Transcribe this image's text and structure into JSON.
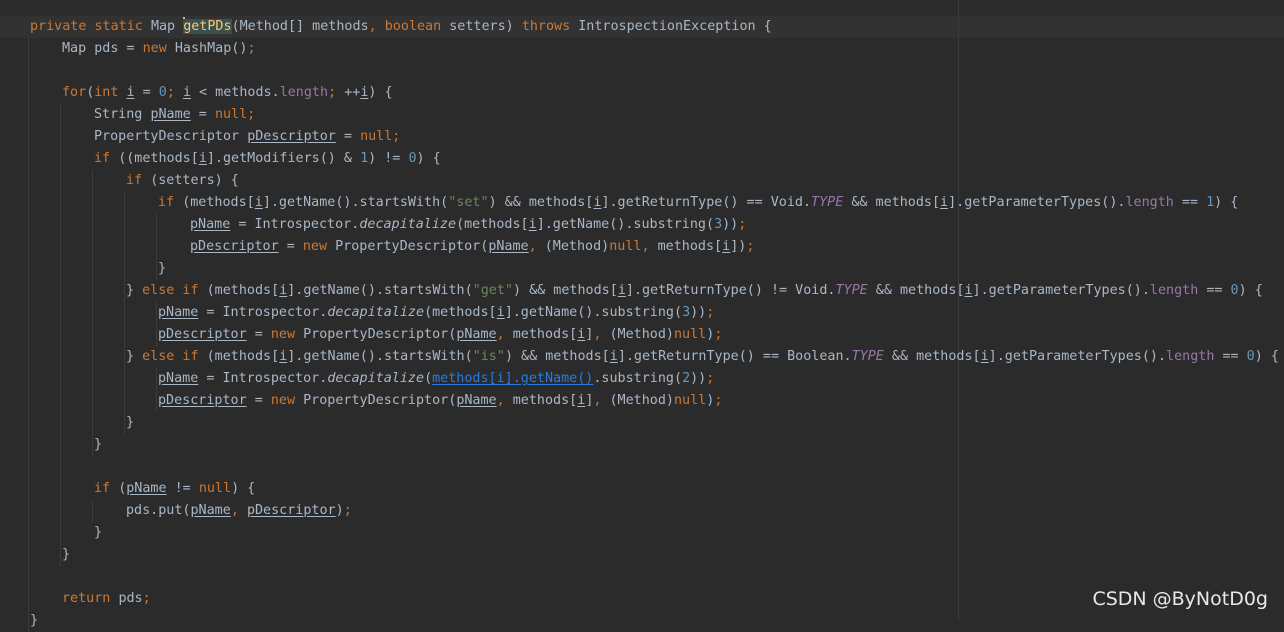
{
  "editor": {
    "lines": [
      {
        "indent": 0,
        "segs": [
          [
            "kw",
            "private static "
          ],
          [
            "",
            "Map "
          ],
          [
            "fn",
            "getPDs"
          ],
          [
            "",
            "(Method[] methods"
          ],
          [
            "kw",
            ", boolean "
          ],
          [
            "",
            "setters) "
          ],
          [
            "kw",
            "throws "
          ],
          [
            "",
            "IntrospectionException {"
          ]
        ]
      },
      {
        "indent": 1,
        "segs": [
          [
            "",
            "Map pds = "
          ],
          [
            "kw",
            "new "
          ],
          [
            "",
            "HashMap()"
          ],
          [
            "kw",
            ";"
          ]
        ]
      },
      {
        "indent": 0,
        "segs": []
      },
      {
        "indent": 1,
        "segs": [
          [
            "kw",
            "for"
          ],
          [
            "",
            "("
          ],
          [
            "kw",
            "int "
          ],
          [
            "u",
            "i"
          ],
          [
            "",
            " = "
          ],
          [
            "num",
            "0"
          ],
          [
            "kw",
            "; "
          ],
          [
            "u",
            "i"
          ],
          [
            "",
            " < methods."
          ],
          [
            "fld",
            "length"
          ],
          [
            "kw",
            "; "
          ],
          [
            "",
            "++"
          ],
          [
            "u",
            "i"
          ],
          [
            "",
            ") {"
          ]
        ]
      },
      {
        "indent": 2,
        "segs": [
          [
            "",
            "String "
          ],
          [
            "u",
            "pName"
          ],
          [
            "",
            " = "
          ],
          [
            "kw",
            "null;"
          ]
        ]
      },
      {
        "indent": 2,
        "segs": [
          [
            "",
            "PropertyDescriptor "
          ],
          [
            "u",
            "pDescriptor"
          ],
          [
            "",
            " = "
          ],
          [
            "kw",
            "null;"
          ]
        ]
      },
      {
        "indent": 2,
        "segs": [
          [
            "kw",
            "if "
          ],
          [
            "",
            "((methods["
          ],
          [
            "u",
            "i"
          ],
          [
            "",
            "].getModifiers() & "
          ],
          [
            "num",
            "1"
          ],
          [
            "",
            ") != "
          ],
          [
            "num",
            "0"
          ],
          [
            "",
            ") {"
          ]
        ]
      },
      {
        "indent": 3,
        "segs": [
          [
            "kw",
            "if "
          ],
          [
            "",
            "(setters) {"
          ]
        ]
      },
      {
        "indent": 4,
        "segs": [
          [
            "kw",
            "if "
          ],
          [
            "",
            "(methods["
          ],
          [
            "u",
            "i"
          ],
          [
            "",
            "].getName().startsWith("
          ],
          [
            "str",
            "\"set\""
          ],
          [
            "",
            ") && methods["
          ],
          [
            "u",
            "i"
          ],
          [
            "",
            "].getReturnType() == Void."
          ],
          [
            "st",
            "TYPE"
          ],
          [
            "",
            " && methods["
          ],
          [
            "u",
            "i"
          ],
          [
            "",
            "].getParameterTypes()."
          ],
          [
            "fld",
            "length"
          ],
          [
            "",
            " == "
          ],
          [
            "num",
            "1"
          ],
          [
            "",
            ") {"
          ]
        ]
      },
      {
        "indent": 5,
        "segs": [
          [
            "u",
            "pName"
          ],
          [
            "",
            " = Introspector."
          ],
          [
            "it",
            "decapitalize"
          ],
          [
            "",
            "(methods["
          ],
          [
            "u",
            "i"
          ],
          [
            "",
            "].getName().substring("
          ],
          [
            "num",
            "3"
          ],
          [
            "",
            "))"
          ],
          [
            "kw",
            ";"
          ]
        ]
      },
      {
        "indent": 5,
        "segs": [
          [
            "u",
            "pDescriptor"
          ],
          [
            "",
            " = "
          ],
          [
            "kw",
            "new "
          ],
          [
            "",
            "PropertyDescriptor("
          ],
          [
            "u",
            "pName"
          ],
          [
            "kw",
            ", "
          ],
          [
            "",
            "(Method)"
          ],
          [
            "kw",
            "null, "
          ],
          [
            "",
            "methods["
          ],
          [
            "u",
            "i"
          ],
          [
            "",
            "])"
          ],
          [
            "kw",
            ";"
          ]
        ]
      },
      {
        "indent": 4,
        "segs": [
          [
            "",
            "}"
          ]
        ]
      },
      {
        "indent": 3,
        "segs": [
          [
            "",
            "} "
          ],
          [
            "kw",
            "else if "
          ],
          [
            "",
            "(methods["
          ],
          [
            "u",
            "i"
          ],
          [
            "",
            "].getName().startsWith("
          ],
          [
            "str",
            "\"get\""
          ],
          [
            "",
            ") && methods["
          ],
          [
            "u",
            "i"
          ],
          [
            "",
            "].getReturnType() != Void."
          ],
          [
            "st",
            "TYPE"
          ],
          [
            "",
            " && methods["
          ],
          [
            "u",
            "i"
          ],
          [
            "",
            "].getParameterTypes()."
          ],
          [
            "fld",
            "length"
          ],
          [
            "",
            " == "
          ],
          [
            "num",
            "0"
          ],
          [
            "",
            ") {"
          ]
        ]
      },
      {
        "indent": 4,
        "segs": [
          [
            "u",
            "pName"
          ],
          [
            "",
            " = Introspector."
          ],
          [
            "it",
            "decapitalize"
          ],
          [
            "",
            "(methods["
          ],
          [
            "u",
            "i"
          ],
          [
            "",
            "].getName().substring("
          ],
          [
            "num",
            "3"
          ],
          [
            "",
            "))"
          ],
          [
            "kw",
            ";"
          ]
        ]
      },
      {
        "indent": 4,
        "segs": [
          [
            "u",
            "pDescriptor"
          ],
          [
            "",
            " = "
          ],
          [
            "kw",
            "new "
          ],
          [
            "",
            "PropertyDescriptor("
          ],
          [
            "u",
            "pName"
          ],
          [
            "kw",
            ", "
          ],
          [
            "",
            "methods["
          ],
          [
            "u",
            "i"
          ],
          [
            "",
            "]"
          ],
          [
            "kw",
            ", "
          ],
          [
            "",
            "(Method)"
          ],
          [
            "kw",
            "null"
          ],
          [
            "",
            ")"
          ],
          [
            "kw",
            ";"
          ]
        ]
      },
      {
        "indent": 3,
        "segs": [
          [
            "",
            "} "
          ],
          [
            "kw",
            "else if "
          ],
          [
            "",
            "(methods["
          ],
          [
            "u",
            "i"
          ],
          [
            "",
            "].getName().startsWith("
          ],
          [
            "str",
            "\"is\""
          ],
          [
            "",
            ") && methods["
          ],
          [
            "u",
            "i"
          ],
          [
            "",
            "].getReturnType() == Boolean."
          ],
          [
            "st",
            "TYPE"
          ],
          [
            "",
            " && methods["
          ],
          [
            "u",
            "i"
          ],
          [
            "",
            "].getParameterTypes()."
          ],
          [
            "fld",
            "length"
          ],
          [
            "",
            " == "
          ],
          [
            "num",
            "0"
          ],
          [
            "",
            ") {"
          ]
        ]
      },
      {
        "indent": 4,
        "segs": [
          [
            "u",
            "pName"
          ],
          [
            "",
            " = Introspector."
          ],
          [
            "it",
            "decapitalize"
          ],
          [
            "",
            "("
          ],
          [
            "lnk",
            "methods[i].getName()"
          ],
          [
            "",
            ".substring("
          ],
          [
            "num",
            "2"
          ],
          [
            "",
            "))"
          ],
          [
            "kw",
            ";"
          ]
        ]
      },
      {
        "indent": 4,
        "segs": [
          [
            "u",
            "pDescriptor"
          ],
          [
            "",
            " = "
          ],
          [
            "kw",
            "new "
          ],
          [
            "",
            "PropertyDescriptor("
          ],
          [
            "u",
            "pName"
          ],
          [
            "kw",
            ", "
          ],
          [
            "",
            "methods["
          ],
          [
            "u",
            "i"
          ],
          [
            "",
            "]"
          ],
          [
            "kw",
            ", "
          ],
          [
            "",
            "(Method)"
          ],
          [
            "kw",
            "null"
          ],
          [
            "",
            ")"
          ],
          [
            "kw",
            ";"
          ]
        ]
      },
      {
        "indent": 3,
        "segs": [
          [
            "",
            "}"
          ]
        ]
      },
      {
        "indent": 2,
        "segs": [
          [
            "",
            "}"
          ]
        ]
      },
      {
        "indent": 0,
        "segs": []
      },
      {
        "indent": 2,
        "segs": [
          [
            "kw",
            "if "
          ],
          [
            "",
            "("
          ],
          [
            "u",
            "pName"
          ],
          [
            "",
            " != "
          ],
          [
            "kw",
            "null"
          ],
          [
            "",
            ") {"
          ]
        ]
      },
      {
        "indent": 3,
        "segs": [
          [
            "",
            "pds.put("
          ],
          [
            "u",
            "pName"
          ],
          [
            "kw",
            ", "
          ],
          [
            "u",
            "pDescriptor"
          ],
          [
            "",
            ")"
          ],
          [
            "kw",
            ";"
          ]
        ]
      },
      {
        "indent": 2,
        "segs": [
          [
            "",
            "}"
          ]
        ]
      },
      {
        "indent": 1,
        "segs": [
          [
            "",
            "}"
          ]
        ]
      },
      {
        "indent": 0,
        "segs": []
      },
      {
        "indent": 1,
        "segs": [
          [
            "kw",
            "return "
          ],
          [
            "",
            "pds"
          ],
          [
            "kw",
            ";"
          ]
        ]
      },
      {
        "indent": 0,
        "segs": [
          [
            "",
            "}"
          ]
        ]
      }
    ]
  },
  "watermark": "CSDN @ByNotD0g"
}
